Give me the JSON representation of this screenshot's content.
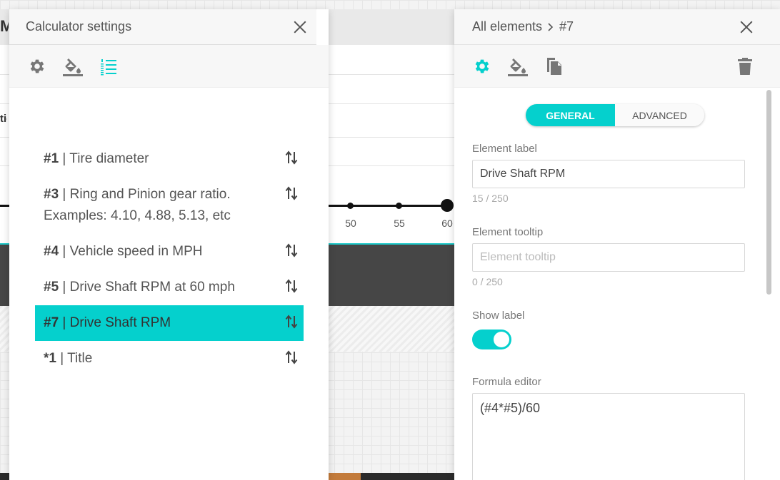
{
  "background": {
    "app_title_fragment": "M",
    "side_label_fragment": "tic",
    "slider_ticks": [
      "50",
      "55",
      "60"
    ],
    "accent_color": "#05d0cd"
  },
  "left_panel": {
    "title": "Calculator settings",
    "toolbar": [
      {
        "icon": "gear-icon"
      },
      {
        "icon": "paint-bucket-icon"
      },
      {
        "icon": "numbered-list-icon",
        "active": true
      }
    ],
    "items": [
      {
        "num": "#1",
        "text": " | Tire diameter",
        "active": false
      },
      {
        "num": "#3",
        "text": " | Ring and Pinion gear ratio. Examples: 4.10, 4.88, 5.13, etc",
        "active": false
      },
      {
        "num": "#4",
        "text": " | Vehicle speed in MPH",
        "active": false
      },
      {
        "num": "#5",
        "text": " | Drive Shaft RPM at 60 mph",
        "active": false
      },
      {
        "num": "#7",
        "text": " | Drive Shaft RPM",
        "active": true
      },
      {
        "num": "*1",
        "text": " | Title",
        "active": false
      }
    ]
  },
  "right_panel": {
    "breadcrumb_root": "All elements",
    "breadcrumb_current": "#7",
    "tabs": {
      "general": "GENERAL",
      "advanced": "ADVANCED"
    },
    "element_label": {
      "label": "Element label",
      "value": "Drive Shaft RPM",
      "counter": "15 / 250"
    },
    "element_tooltip": {
      "label": "Element tooltip",
      "placeholder": "Element tooltip",
      "counter": "0 / 250"
    },
    "show_label": {
      "label": "Show label",
      "on": true
    },
    "formula": {
      "label": "Formula editor",
      "value": "(#4*#5)/60"
    }
  }
}
